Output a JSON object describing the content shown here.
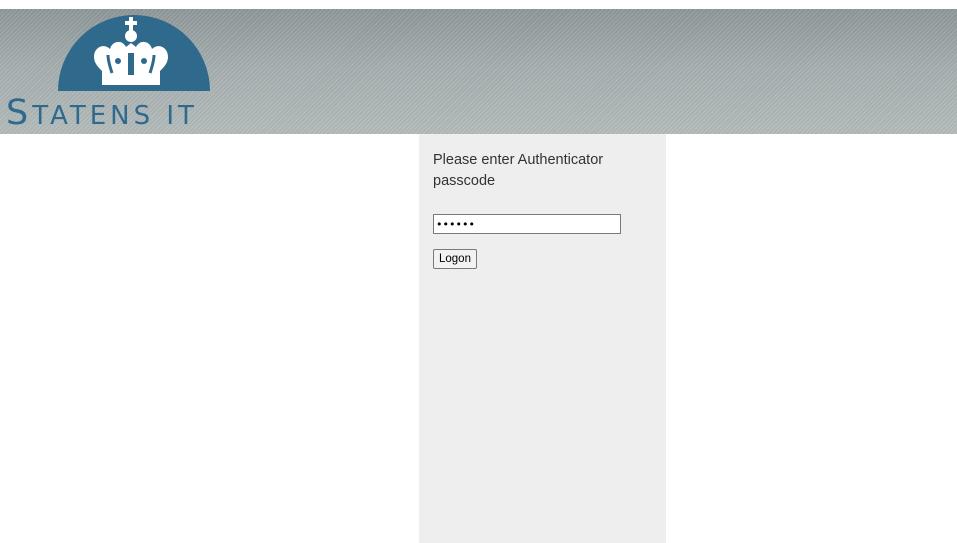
{
  "header": {
    "brand_first_letter": "S",
    "brand_rest": "TATENS IT"
  },
  "login": {
    "prompt": "Please enter Authenticator passcode",
    "passcode_value": "••••••",
    "logon_label": "Logon"
  },
  "colors": {
    "brand": "#2f6a8c",
    "header_gradient_top": "#8e9799",
    "header_gradient_bottom": "#b3bbbb",
    "panel_background": "#eeeeee"
  },
  "icons": {
    "logo": "crown-icon"
  }
}
